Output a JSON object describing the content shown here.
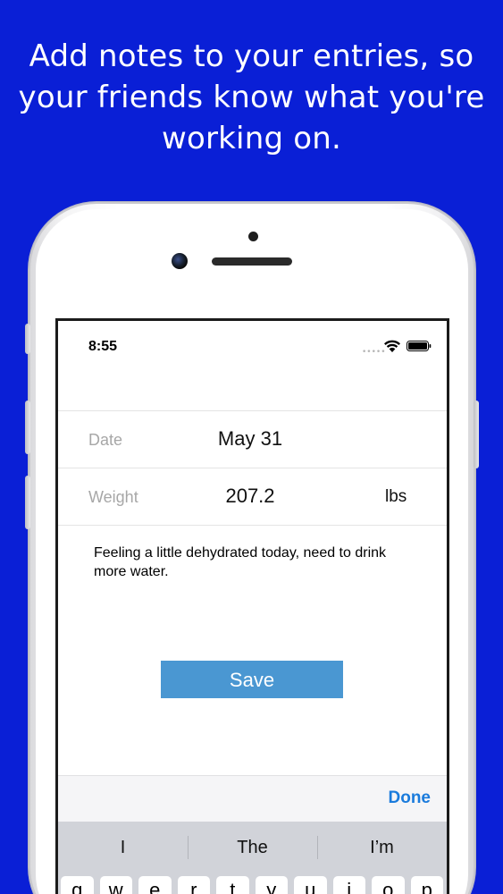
{
  "headline": {
    "line1": "Add notes to your entries, so",
    "line2": "your friends know what you're",
    "line3": "working on."
  },
  "status_bar": {
    "time": "8:55",
    "signal": "•••••",
    "wifi_icon": "wifi-icon",
    "battery_icon": "battery-icon"
  },
  "form": {
    "date_label": "Date",
    "date_value": "May 31",
    "weight_label": "Weight",
    "weight_value": "207.2",
    "weight_unit": "lbs",
    "notes": "Feeling a little dehydrated today, need to drink more water."
  },
  "save_label": "Save",
  "accessory": {
    "done_label": "Done"
  },
  "keyboard": {
    "suggestions": [
      "I",
      "The",
      "I’m"
    ],
    "keys": [
      "q",
      "w",
      "e",
      "r",
      "t",
      "y",
      "u",
      "i",
      "o",
      "p"
    ]
  },
  "colors": {
    "background": "#0a1fd6",
    "save_button": "#4a97d2",
    "done": "#1a7bdc",
    "keyboard": "#d1d3d9"
  }
}
